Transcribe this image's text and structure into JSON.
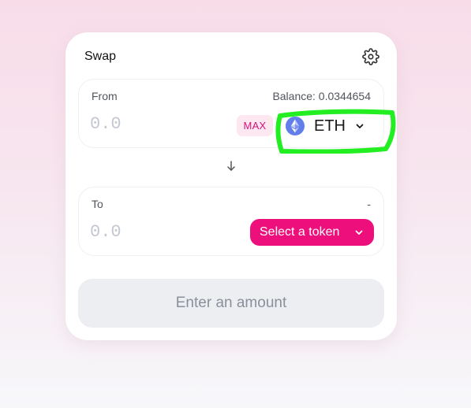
{
  "header": {
    "title": "Swap",
    "settings_icon": "gear-icon"
  },
  "from": {
    "label": "From",
    "balance": "Balance: 0.0344654",
    "amount_placeholder": "0.0",
    "max_label": "MAX",
    "token": {
      "symbol": "ETH",
      "icon": "ethereum-icon"
    }
  },
  "switch_icon": "arrow-down-icon",
  "to": {
    "label": "To",
    "balance": "-",
    "amount_placeholder": "0.0",
    "select_label": "Select a token"
  },
  "action": {
    "label": "Enter an amount"
  },
  "colors": {
    "accent": "#ed0f7b",
    "max_bg": "#fde8f1",
    "max_text": "#d5137a",
    "eth_icon": "#627eea",
    "annotation": "#22ee22"
  }
}
